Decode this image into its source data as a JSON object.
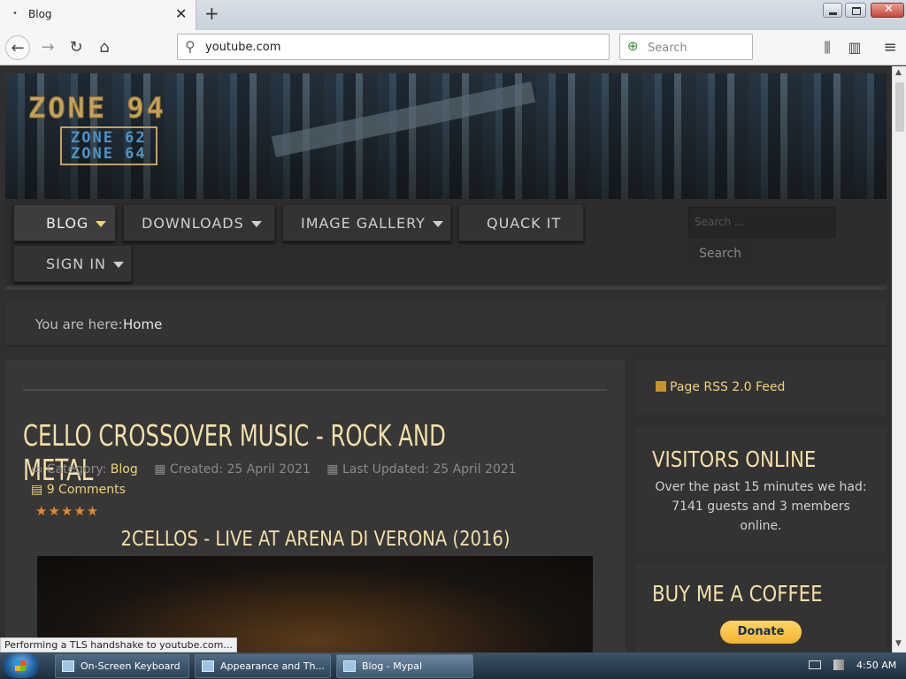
{
  "browser": {
    "tab_title": "Blog",
    "tab_dot": "•",
    "url": "youtube.com",
    "search_placeholder": "Search",
    "status_text": "Performing a TLS handshake to youtube.com..."
  },
  "site": {
    "logo_main": "ZONE 94",
    "logo_sub_1": "ZONE 62",
    "logo_sub_2": "ZONE 64",
    "menu": {
      "blog": "BLOG",
      "downloads": "DOWNLOADS",
      "gallery": "IMAGE GALLERY",
      "quack": "QUACK IT",
      "signin": "SIGN IN"
    },
    "search_placeholder": "Search ...",
    "search_button": "Search",
    "breadcrumb_label": "You are here:",
    "breadcrumb_home": "Home"
  },
  "article": {
    "title": "CELLO CROSSOVER MUSIC - ROCK AND METAL",
    "category_label": "Category:",
    "category": "Blog",
    "created": "Created: 25 April 2021",
    "updated": "Last Updated: 25 April 2021",
    "comments": "9 Comments",
    "stars": "★★★★★",
    "video_title": "2CELLOS - LIVE AT ARENA DI VERONA (2016)"
  },
  "sidebar": {
    "rss": "Page RSS 2.0 Feed",
    "visitors_title": "VISITORS ONLINE",
    "visitors_text": "Over the past 15 minutes we had: 7141 guests and 3 members online.",
    "coffee_title": "BUY ME A COFFEE",
    "donate": "Donate"
  },
  "taskbar": {
    "osk": "On-Screen Keyboard",
    "appearance": "Appearance and Th...",
    "blog": "Blog - Mypal",
    "clock": "4:50 AM"
  },
  "colors": {
    "accent": "#f1d277",
    "title": "#f3dfa8",
    "star": "#e8862a"
  }
}
